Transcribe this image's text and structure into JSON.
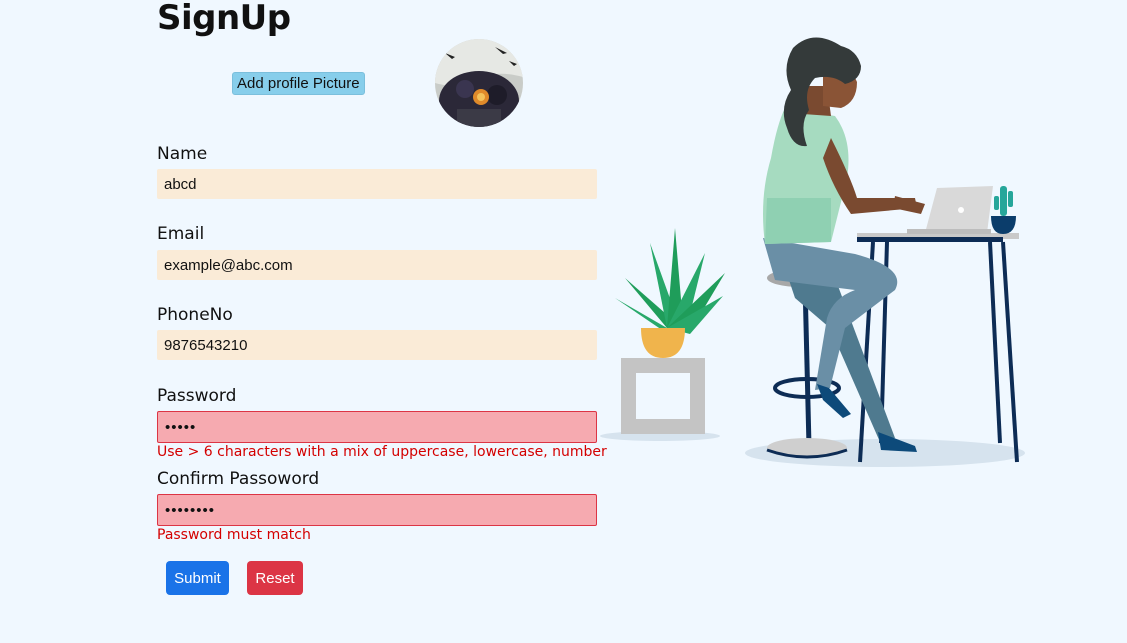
{
  "page": {
    "title": "SignUp"
  },
  "profile": {
    "add_picture_label": "Add profile Picture"
  },
  "form": {
    "name": {
      "label": "Name",
      "value": "abcd"
    },
    "email": {
      "label": "Email",
      "value": "example@abc.com"
    },
    "phone": {
      "label": "PhoneNo",
      "value": "9876543210"
    },
    "password": {
      "label": "Password",
      "value": "•••••",
      "error": "Use > 6 characters with a mix of uppercase, lowercase, number"
    },
    "confirm_password": {
      "label": "Confirm Passoword",
      "value": "••••••••",
      "error": "Password must match"
    }
  },
  "actions": {
    "submit_label": "Submit",
    "reset_label": "Reset"
  },
  "colors": {
    "background": "#f0f8ff",
    "input_bg": "#faebd7",
    "invalid_bg": "#f6aab0",
    "error": "#d40000",
    "submit": "#1a73e8",
    "reset": "#dc3545",
    "add_picture_bg": "#87ceeb"
  }
}
